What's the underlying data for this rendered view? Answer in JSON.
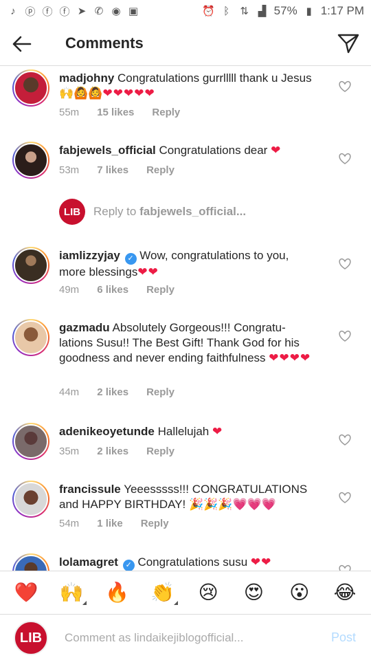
{
  "status_bar": {
    "battery": "57%",
    "time": "1:17 PM",
    "icons": [
      "tiktok-icon",
      "pinterest-icon",
      "facebook-icon",
      "facebook-icon",
      "telegram-icon",
      "whatsapp-icon",
      "messenger-icon",
      "gallery-icon",
      "alarm-icon",
      "bluetooth-icon",
      "network-icon",
      "signal-icon",
      "battery-icon"
    ]
  },
  "header": {
    "title": "Comments"
  },
  "comments": [
    {
      "username": "madjohny",
      "verified": false,
      "text": "Congratulations gurrlllll thank u Jesus 🙌🙆🙆",
      "hearts": "❤❤❤❤❤",
      "time": "55m",
      "likes": "15 likes",
      "reply": "Reply"
    },
    {
      "username": "fabjewels_official",
      "verified": false,
      "text": "Congratulations dear",
      "hearts": "❤",
      "time": "53m",
      "likes": "7 likes",
      "reply": "Reply"
    },
    {
      "username": "iamlizzyjay",
      "verified": true,
      "text": "Wow, congratulations to you, more blessings",
      "hearts": "❤❤",
      "time": "49m",
      "likes": "6 likes",
      "reply": "Reply"
    },
    {
      "username": "gazmadu",
      "verified": false,
      "text": "Absolutely Gorgeous!!! Congratu-lations Susu!! The Best Gift! Thank God for his goodness and never ending faithfulness",
      "hearts": "❤❤❤❤",
      "time": "44m",
      "likes": "2 likes",
      "reply": "Reply"
    },
    {
      "username": "adenikeoyetunde",
      "verified": false,
      "text": "Hallelujah",
      "hearts": "❤",
      "time": "35m",
      "likes": "2 likes",
      "reply": "Reply"
    },
    {
      "username": "francissule",
      "verified": false,
      "text": "Yeeesssss!!! CONGRATULATIONS and HAPPY BIRTHDAY! 🎉🎉🎉💗💗💗",
      "hearts": "",
      "time": "54m",
      "likes": "1 like",
      "reply": "Reply"
    },
    {
      "username": "lolamagret",
      "verified": true,
      "text": "Congratulations susu",
      "hearts": "❤❤",
      "time": "",
      "likes": "",
      "reply": ""
    }
  ],
  "reply_prompt": {
    "prefix": "Reply to ",
    "target": "fabjewels_official...",
    "avatar_text": "LIB"
  },
  "emoji_bar": [
    "❤️",
    "🙌",
    "🔥",
    "👏",
    "😢",
    "😍",
    "😮",
    "😂"
  ],
  "composer": {
    "avatar_text": "LIB",
    "placeholder": "Comment as lindaikejiblogofficial...",
    "post_label": "Post"
  },
  "colors": {
    "heart": "#ed1c45",
    "verified": "#3897f0",
    "post": "#b3dbff",
    "lib_red": "#c8102e"
  }
}
